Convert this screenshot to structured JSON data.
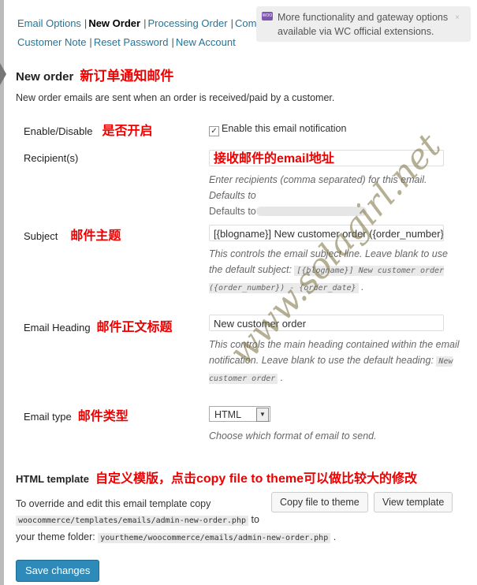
{
  "nav": {
    "items": [
      {
        "label": "Email Options"
      },
      {
        "label": "New Order",
        "current": true
      },
      {
        "label": "Processing Order"
      },
      {
        "label": "Comp"
      },
      {
        "label": "Customer Note"
      },
      {
        "label": "Reset Password"
      },
      {
        "label": "New Account"
      }
    ]
  },
  "notice": {
    "text": "More functionality and gateway options available via ",
    "link": "WC official extensions",
    "end": ".",
    "close": "×",
    "logo": "WOO"
  },
  "section": {
    "title": "New order",
    "title_cn": "新订单通知邮件",
    "description": "New order emails are sent when an order is received/paid by a customer."
  },
  "fields": {
    "enable": {
      "label": "Enable/Disable",
      "label_cn": "是否开启",
      "checkbox_label": "Enable this email notification",
      "checked": true
    },
    "recipient": {
      "label": "Recipient(s)",
      "value_cn": "接收邮件的email地址",
      "desc": "Enter recipients (comma separated) for this email. Defaults to"
    },
    "subject": {
      "label": "Subject",
      "label_cn": "邮件主题",
      "value": "[{blogname}] New customer order ({order_number}) -",
      "desc": "This controls the email subject line. Leave blank to use the default subject:",
      "code": "[{blogname}] New customer order ({order_number}) - {order_date}",
      "end": "."
    },
    "heading": {
      "label": "Email Heading",
      "label_cn": "邮件正文标题",
      "value": "New customer order",
      "desc": "This controls the main heading contained within the email notification. Leave blank to use the default heading:",
      "code": "New customer order",
      "end": "."
    },
    "type": {
      "label": "Email type",
      "label_cn": "邮件类型",
      "value": "HTML",
      "desc": "Choose which format of email to send."
    }
  },
  "template": {
    "title": "HTML template",
    "title_cn": "自定义模版，点击copy file to theme可以做比较大的修改",
    "text1": "To override and edit this email template copy",
    "path1": "woocommerce/templates/emails/admin-new-order.php",
    "text2": "to",
    "text3": "your theme folder:",
    "path2": "yourtheme/woocommerce/emails/admin-new-order.php",
    "end": ".",
    "copy_btn": "Copy file to theme",
    "view_btn": "View template"
  },
  "save": "Save changes",
  "watermark": "www.solagirl.net"
}
